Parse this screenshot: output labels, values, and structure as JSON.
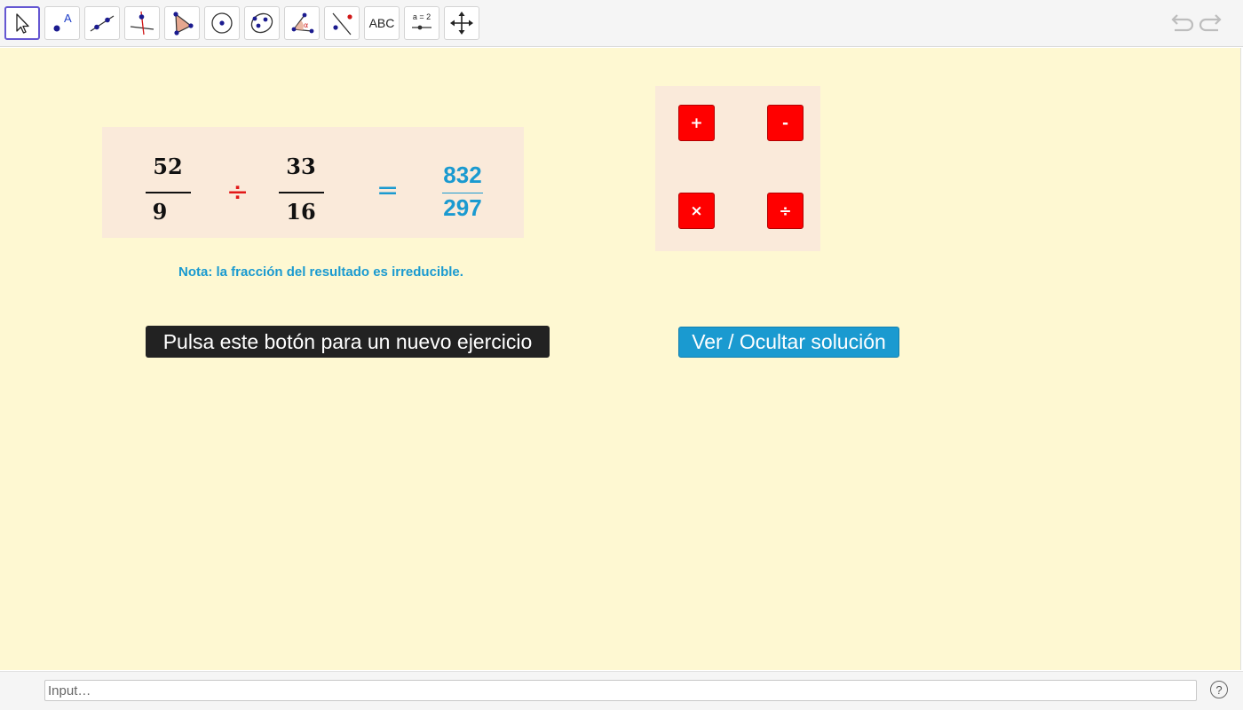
{
  "toolbar": {
    "text_tool_label": "ABC",
    "slider_tool_label": "a = 2"
  },
  "exercise": {
    "fraction1": {
      "numerator": "52",
      "denominator": "9"
    },
    "operator": "÷",
    "fraction2": {
      "numerator": "33",
      "denominator": "16"
    },
    "equals": "=",
    "result": {
      "numerator": "832",
      "denominator": "297"
    },
    "note": "Nota: la fracción del resultado es irreducible."
  },
  "operations": {
    "add": "+",
    "subtract": "-",
    "multiply": "×",
    "divide": "÷"
  },
  "buttons": {
    "new_exercise": "Pulsa este botón para un nuevo ejercicio",
    "toggle_solution": "Ver / Ocultar solución"
  },
  "input_bar": {
    "placeholder": "Input…",
    "help": "?"
  },
  "colors": {
    "canvas_bg": "#fef8d2",
    "panel_bg": "#faeada",
    "accent_blue": "#1a9ad0",
    "operator_red": "#e21818",
    "op_button_red": "#ff0000",
    "tool_active": "#6557d2"
  }
}
